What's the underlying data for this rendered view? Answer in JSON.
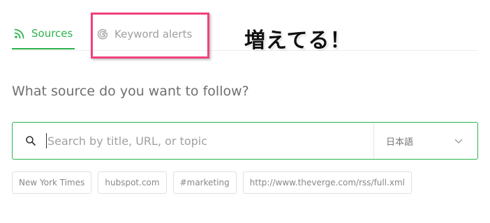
{
  "tabs": {
    "sources_label": "Sources",
    "keyword_alerts_label": "Keyword alerts"
  },
  "annotation": {
    "text": "増えてる！",
    "box_color": "#f2417c"
  },
  "heading": "What source do you want to follow?",
  "search": {
    "placeholder": "Search by title, URL, or topic",
    "value": ""
  },
  "language": {
    "selected": "日本語"
  },
  "suggestions": [
    "New York Times",
    "hubspot.com",
    "#marketing",
    "http://www.theverge.com/rss/full.xml"
  ],
  "colors": {
    "accent": "#2bb24c",
    "muted_text": "#9e9e9e"
  },
  "icons": {
    "sources": "rss-icon",
    "keyword_alerts": "google-icon",
    "search": "search-icon",
    "language": "chevron-down-icon"
  }
}
